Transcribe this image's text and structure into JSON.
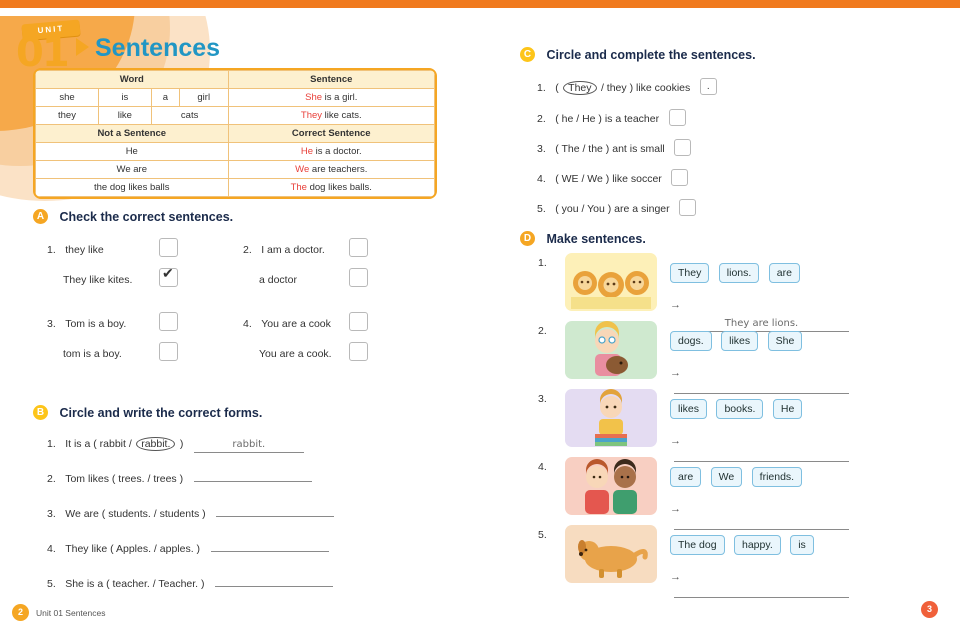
{
  "unit": {
    "ribbon_label": "UNIT",
    "number": "01",
    "title": "Sentences"
  },
  "grammar_box": {
    "header_left": "Word",
    "header_right": "Sentence",
    "rows": [
      {
        "cells": [
          "she",
          "is",
          "a",
          "girl"
        ],
        "sentence": "She is a girl.",
        "sentence_bold": "She"
      },
      {
        "cells": [
          "they",
          "like",
          "cats"
        ],
        "sentence": "They like cats.",
        "sentence_bold": "They"
      }
    ],
    "header2_left": "Not a Sentence",
    "header2_right": "Correct Sentence",
    "rows2": [
      {
        "left": "He",
        "right": "He is a doctor.",
        "bold": "He"
      },
      {
        "left": "We are",
        "right": "We are teachers.",
        "bold": "We"
      },
      {
        "left": "the dog likes balls",
        "right": "The dog likes balls.",
        "bold": "The"
      }
    ]
  },
  "sectionA": {
    "marker": "A",
    "title": "Check the correct sentences.",
    "items": [
      {
        "num": "1.",
        "text": "they like",
        "checked": false
      },
      {
        "num": "",
        "text": "They like kites.",
        "checked": true
      },
      {
        "num": "2.",
        "text": "I am a doctor.",
        "checked": false
      },
      {
        "num": "",
        "text": "a doctor",
        "checked": false
      },
      {
        "num": "3.",
        "text": "Tom is a boy.",
        "checked": false
      },
      {
        "num": "",
        "text": "tom is a boy.",
        "checked": false
      },
      {
        "num": "4.",
        "text": "You are a cook",
        "checked": false
      },
      {
        "num": "",
        "text": "You are a cook.",
        "checked": false
      }
    ]
  },
  "sectionB": {
    "marker": "B",
    "title": "Circle and write the correct forms.",
    "items": [
      {
        "num": "1.",
        "prefix": "It is a ( rabbit /",
        "circled": "rabbit.",
        "suffix": ")",
        "answer": "rabbit."
      },
      {
        "num": "2.",
        "prefix": "Tom likes ( trees. / trees )",
        "circled": "",
        "suffix": "",
        "answer": ""
      },
      {
        "num": "3.",
        "prefix": "We are ( students. / students )",
        "circled": "",
        "suffix": "",
        "answer": ""
      },
      {
        "num": "4.",
        "prefix": "They like ( Apples. / apples. )",
        "circled": "",
        "suffix": "",
        "answer": ""
      },
      {
        "num": "5.",
        "prefix": "She is a ( teacher. / Teacher. )",
        "circled": "",
        "suffix": "",
        "answer": ""
      }
    ]
  },
  "sectionC": {
    "marker": "C",
    "title": "Circle and complete the sentences.",
    "items": [
      {
        "num": "1.",
        "open": "(",
        "circled": "They",
        "rest": "/ they ) like cookies",
        "box_value": ".",
        "has_box": true
      },
      {
        "num": "2.",
        "open": "(",
        "circled": "",
        "rest": "he / He ) is a teacher",
        "box_value": "",
        "has_box": true
      },
      {
        "num": "3.",
        "open": "(",
        "circled": "",
        "rest": "The / the ) ant is small",
        "box_value": "",
        "has_box": true
      },
      {
        "num": "4.",
        "open": "(",
        "circled": "",
        "rest": "WE / We ) like soccer",
        "box_value": "",
        "has_box": true
      },
      {
        "num": "5.",
        "open": "(",
        "circled": "",
        "rest": "you / You ) are a singer",
        "box_value": "",
        "has_box": true
      }
    ]
  },
  "sectionD": {
    "marker": "D",
    "title": "Make sentences.",
    "items": [
      {
        "num": "1.",
        "tokens": [
          "They",
          "lions.",
          "are"
        ],
        "answer": "They are lions.",
        "image": "three-lions"
      },
      {
        "num": "2.",
        "tokens": [
          "dogs.",
          "likes",
          "She"
        ],
        "answer": "",
        "image": "girl-with-dog"
      },
      {
        "num": "3.",
        "tokens": [
          "likes",
          "books.",
          "He"
        ],
        "answer": "",
        "image": "boy-with-books"
      },
      {
        "num": "4.",
        "tokens": [
          "are",
          "We",
          "friends."
        ],
        "answer": "",
        "image": "two-friends"
      },
      {
        "num": "5.",
        "tokens": [
          "The dog",
          "happy.",
          "is"
        ],
        "answer": "",
        "image": "happy-dog"
      }
    ]
  },
  "footer": {
    "left_page_number": "2",
    "left_text": "Unit 01   Sentences",
    "right_page_number": "3"
  },
  "colors": {
    "accent_orange": "#f5a623",
    "title_blue": "#2196c4",
    "red": "#e8413b",
    "token_border": "#7fbfe0",
    "token_fill": "#eaf6fc"
  }
}
